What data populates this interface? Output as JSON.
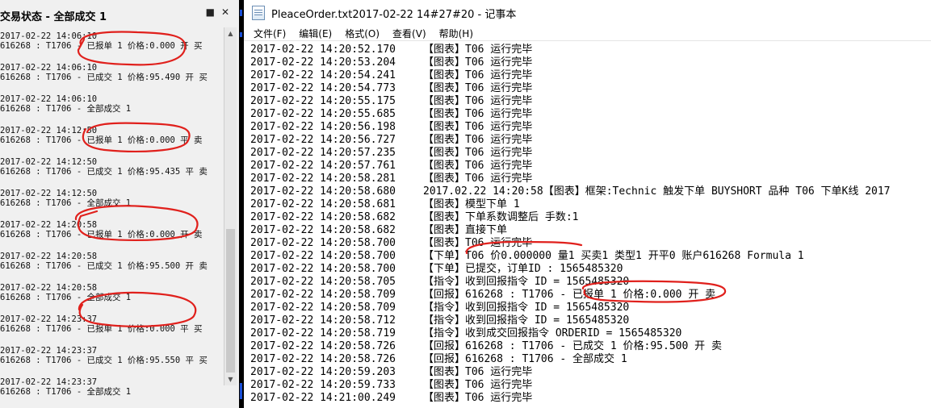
{
  "left_panel": {
    "title": "交易状态 - 全部成交 1",
    "pin_icon": "pin-icon",
    "close_icon": "close-icon",
    "entries": [
      {
        "time": "2017-02-22 14:06:10",
        "detail": "616268 : T1706 - 已报单 1 价格:0.000 开 买"
      },
      {
        "time": "2017-02-22 14:06:10",
        "detail": "616268 : T1706 - 已成交 1 价格:95.490 开 买"
      },
      {
        "time": "2017-02-22 14:06:10",
        "detail": "616268 : T1706 - 全部成交 1"
      },
      {
        "time": "2017-02-22 14:12:50",
        "detail": "616268 : T1706 - 已报单 1 价格:0.000 平 卖"
      },
      {
        "time": "2017-02-22 14:12:50",
        "detail": "616268 : T1706 - 已成交 1 价格:95.435 平 卖"
      },
      {
        "time": "2017-02-22 14:12:50",
        "detail": "616268 : T1706 - 全部成交 1"
      },
      {
        "time": "2017-02-22 14:20:58",
        "detail": "616268 : T1706 - 已报单 1 价格:0.000 开 卖"
      },
      {
        "time": "2017-02-22 14:20:58",
        "detail": "616268 : T1706 - 已成交 1 价格:95.500 开 卖"
      },
      {
        "time": "2017-02-22 14:20:58",
        "detail": "616268 : T1706 - 全部成交 1"
      },
      {
        "time": "2017-02-22 14:23:37",
        "detail": "616268 : T1706 - 已报单 1 价格:0.000 平 买"
      },
      {
        "time": "2017-02-22 14:23:37",
        "detail": "616268 : T1706 - 已成交 1 价格:95.550 平 买"
      },
      {
        "time": "2017-02-22 14:23:37",
        "detail": "616268 : T1706 - 全部成交 1"
      }
    ]
  },
  "notepad": {
    "title": "PleaceOrder.txt2017-02-22 14#27#20 - 记事本",
    "menu": [
      "文件(F)",
      "编辑(E)",
      "格式(O)",
      "查看(V)",
      "帮助(H)"
    ],
    "lines": [
      {
        "ts": "2017-02-22 14:20:52.170",
        "msg": "【图表】T06 运行完毕"
      },
      {
        "ts": "2017-02-22 14:20:53.204",
        "msg": "【图表】T06 运行完毕"
      },
      {
        "ts": "2017-02-22 14:20:54.241",
        "msg": "【图表】T06 运行完毕"
      },
      {
        "ts": "2017-02-22 14:20:54.773",
        "msg": "【图表】T06 运行完毕"
      },
      {
        "ts": "2017-02-22 14:20:55.175",
        "msg": "【图表】T06 运行完毕"
      },
      {
        "ts": "2017-02-22 14:20:55.685",
        "msg": "【图表】T06 运行完毕"
      },
      {
        "ts": "2017-02-22 14:20:56.198",
        "msg": "【图表】T06 运行完毕"
      },
      {
        "ts": "2017-02-22 14:20:56.727",
        "msg": "【图表】T06 运行完毕"
      },
      {
        "ts": "2017-02-22 14:20:57.235",
        "msg": "【图表】T06 运行完毕"
      },
      {
        "ts": "2017-02-22 14:20:57.761",
        "msg": "【图表】T06 运行完毕"
      },
      {
        "ts": "2017-02-22 14:20:58.281",
        "msg": "【图表】T06 运行完毕"
      },
      {
        "ts": "2017-02-22 14:20:58.680",
        "msg": "2017.02.22 14:20:58【图表】框架:Technic 触发下单 BUYSHORT 品种 T06 下单K线 2017"
      },
      {
        "ts": "2017-02-22 14:20:58.681",
        "msg": "【图表】模型下单 1"
      },
      {
        "ts": "2017-02-22 14:20:58.682",
        "msg": "【图表】下单系数调整后 手数:1"
      },
      {
        "ts": "2017-02-22 14:20:58.682",
        "msg": "【图表】直接下单"
      },
      {
        "ts": "2017-02-22 14:20:58.700",
        "msg": "【图表】T06 运行完毕"
      },
      {
        "ts": "2017-02-22 14:20:58.700",
        "msg": "【下单】T06 价0.000000 量1 买卖1 类型1 开平0 账户616268 Formula 1"
      },
      {
        "ts": "2017-02-22 14:20:58.700",
        "msg": "【下单】已提交，订单ID : 1565485320"
      },
      {
        "ts": "2017-02-22 14:20:58.705",
        "msg": "【指令】收到回报指令 ID = 1565485320"
      },
      {
        "ts": "2017-02-22 14:20:58.709",
        "msg": "【回报】616268 : T1706 - 已报单 1 价格:0.000 开 卖"
      },
      {
        "ts": "2017-02-22 14:20:58.709",
        "msg": "【指令】收到回报指令 ID = 1565485320"
      },
      {
        "ts": "2017-02-22 14:20:58.712",
        "msg": "【指令】收到回报指令 ID = 1565485320"
      },
      {
        "ts": "2017-02-22 14:20:58.719",
        "msg": "【指令】收到成交回报指令 ORDERID = 1565485320"
      },
      {
        "ts": "2017-02-22 14:20:58.726",
        "msg": "【回报】616268 : T1706 - 已成交 1 价格:95.500 开 卖"
      },
      {
        "ts": "2017-02-22 14:20:58.726",
        "msg": "【回报】616268 : T1706 - 全部成交 1"
      },
      {
        "ts": "2017-02-22 14:20:59.203",
        "msg": "【图表】T06 运行完毕"
      },
      {
        "ts": "2017-02-22 14:20:59.733",
        "msg": "【图表】T06 运行完毕"
      },
      {
        "ts": "2017-02-22 14:21:00.249",
        "msg": "【图表】T06 运行完毕"
      }
    ]
  },
  "colors": {
    "annotation": "#e0201c",
    "scroll_accent": "#1a4fd8"
  }
}
